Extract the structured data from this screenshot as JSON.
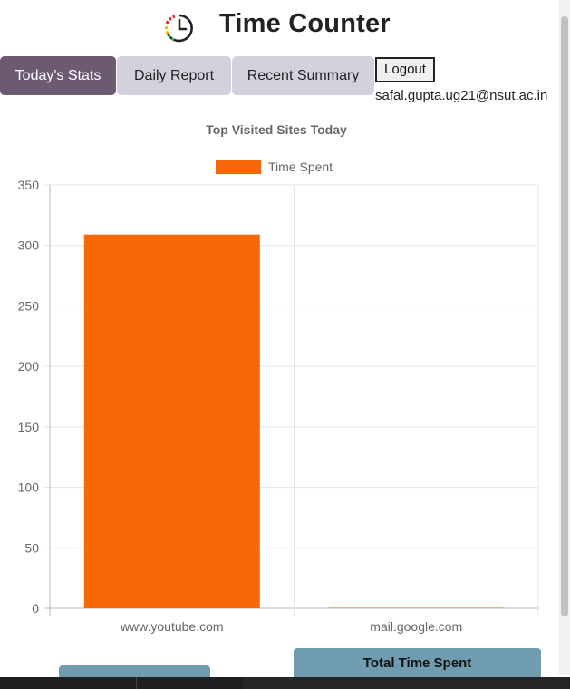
{
  "app": {
    "title": "Time Counter"
  },
  "tabs": [
    {
      "label": "Today's Stats",
      "active": true
    },
    {
      "label": "Daily Report",
      "active": false
    },
    {
      "label": "Recent Summary",
      "active": false
    }
  ],
  "user": {
    "logout_label": "Logout",
    "email": "safal.gupta.ug21@nsut.ac.in"
  },
  "stats_buttons": {
    "total_time_label": "Total Time Spent",
    "left_label": ""
  },
  "colors": {
    "bar": "#f76809",
    "active_tab": "#6b5a70",
    "tab": "#d4d1de",
    "stat_button": "#6f9caf"
  },
  "chart_data": {
    "type": "bar",
    "title": "Top Visited Sites Today",
    "legend_position": "top",
    "grid": true,
    "categories": [
      "www.youtube.com",
      "mail.google.com"
    ],
    "series": [
      {
        "name": "Time Spent",
        "values": [
          309,
          1
        ],
        "color": "#f76809"
      }
    ],
    "ylim": [
      0,
      350
    ],
    "yticks": [
      0,
      50,
      100,
      150,
      200,
      250,
      300,
      350
    ],
    "xlabel": "",
    "ylabel": ""
  }
}
